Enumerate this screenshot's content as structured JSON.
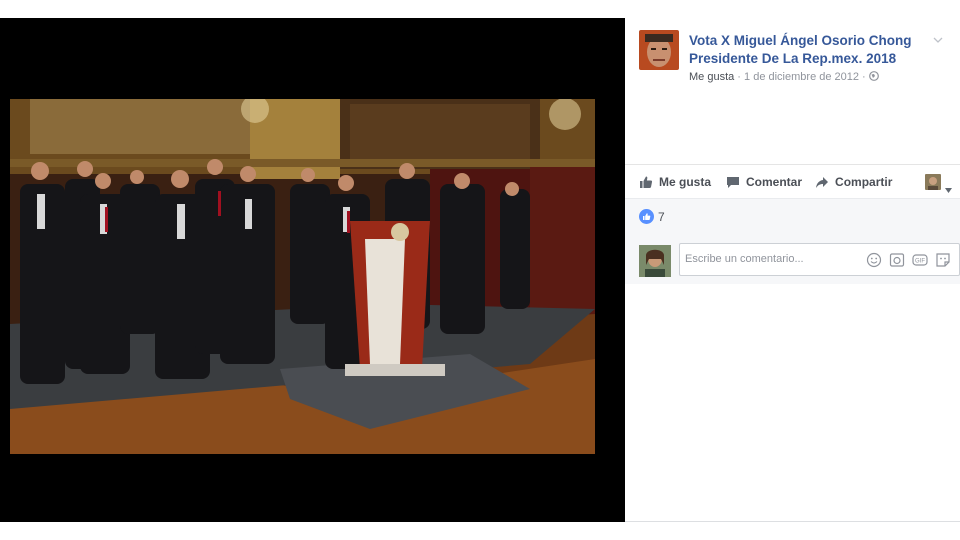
{
  "post": {
    "page_name": "Vota X Miguel Ángel Osorio Chong Presidente De La Rep.mex. 2018",
    "like_link": "Me gusta",
    "separator": " · ",
    "date": "1 de diciembre de 2012",
    "separator2": " · "
  },
  "actions": {
    "like": "Me gusta",
    "comment": "Comentar",
    "share": "Compartir"
  },
  "reactions": {
    "count": "7"
  },
  "comment": {
    "placeholder": "Escribe un comentario..."
  },
  "icons": {
    "globe": "globe-icon",
    "chevron": "chevron-down-icon",
    "like": "thumbs-up-icon",
    "comment": "speech-bubble-icon",
    "share": "share-arrow-icon",
    "emoji": "emoji-icon",
    "camera": "camera-icon",
    "gif": "gif-icon",
    "sticker": "sticker-icon"
  },
  "colors": {
    "link": "#365899",
    "muted": "#90949c",
    "text": "#4b4f56",
    "like_blue": "#5890ff"
  }
}
